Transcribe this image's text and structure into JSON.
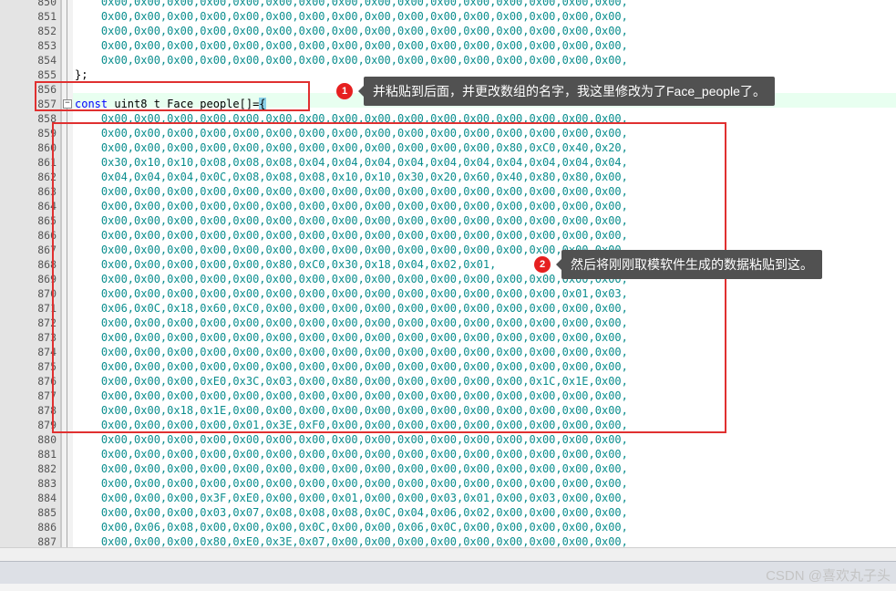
{
  "editor": {
    "lines": [
      {
        "no": "850",
        "text": "    0x00,0x00,0x00,0x00,0x00,0x00,0x00,0x00,0x00,0x00,0x00,0x00,0x00,0x00,0x00,0x00,"
      },
      {
        "no": "851",
        "text": "    0x00,0x00,0x00,0x00,0x00,0x00,0x00,0x00,0x00,0x00,0x00,0x00,0x00,0x00,0x00,0x00,"
      },
      {
        "no": "852",
        "text": "    0x00,0x00,0x00,0x00,0x00,0x00,0x00,0x00,0x00,0x00,0x00,0x00,0x00,0x00,0x00,0x00,"
      },
      {
        "no": "853",
        "text": "    0x00,0x00,0x00,0x00,0x00,0x00,0x00,0x00,0x00,0x00,0x00,0x00,0x00,0x00,0x00,0x00,"
      },
      {
        "no": "854",
        "text": "    0x00,0x00,0x00,0x00,0x00,0x00,0x00,0x00,0x00,0x00,0x00,0x00,0x00,0x00,0x00,0x00,"
      },
      {
        "no": "855",
        "text": "};"
      },
      {
        "no": "856",
        "text": ""
      },
      {
        "no": "857",
        "text": ""
      },
      {
        "no": "858",
        "text": "    0x00,0x00,0x00,0x00,0x00,0x00,0x00,0x00,0x00,0x00,0x00,0x00,0x00,0x00,0x00,0x00,"
      },
      {
        "no": "859",
        "text": "    0x00,0x00,0x00,0x00,0x00,0x00,0x00,0x00,0x00,0x00,0x00,0x00,0x00,0x00,0x00,0x00,"
      },
      {
        "no": "860",
        "text": "    0x00,0x00,0x00,0x00,0x00,0x00,0x00,0x00,0x00,0x00,0x00,0x00,0x80,0xC0,0x40,0x20,"
      },
      {
        "no": "861",
        "text": "    0x30,0x10,0x10,0x08,0x08,0x08,0x04,0x04,0x04,0x04,0x04,0x04,0x04,0x04,0x04,0x04,"
      },
      {
        "no": "862",
        "text": "    0x04,0x04,0x04,0x0C,0x08,0x08,0x08,0x10,0x10,0x30,0x20,0x60,0x40,0x80,0x80,0x00,"
      },
      {
        "no": "863",
        "text": "    0x00,0x00,0x00,0x00,0x00,0x00,0x00,0x00,0x00,0x00,0x00,0x00,0x00,0x00,0x00,0x00,"
      },
      {
        "no": "864",
        "text": "    0x00,0x00,0x00,0x00,0x00,0x00,0x00,0x00,0x00,0x00,0x00,0x00,0x00,0x00,0x00,0x00,"
      },
      {
        "no": "865",
        "text": "    0x00,0x00,0x00,0x00,0x00,0x00,0x00,0x00,0x00,0x00,0x00,0x00,0x00,0x00,0x00,0x00,"
      },
      {
        "no": "866",
        "text": "    0x00,0x00,0x00,0x00,0x00,0x00,0x00,0x00,0x00,0x00,0x00,0x00,0x00,0x00,0x00,0x00,"
      },
      {
        "no": "867",
        "text": "    0x00,0x00,0x00,0x00,0x00,0x00,0x00,0x00,0x00,0x00,0x00,0x00,0x00,0x00,0x00,0x00,"
      },
      {
        "no": "868",
        "text": "    0x00,0x00,0x00,0x00,0x00,0x80,0xC0,0x30,0x18,0x04,0x02,0x01,"
      },
      {
        "no": "869",
        "text": "    0x00,0x00,0x00,0x00,0x00,0x00,0x00,0x00,0x00,0x00,0x00,0x00,0x00,0x00,0x00,0x00,"
      },
      {
        "no": "870",
        "text": "    0x00,0x00,0x00,0x00,0x00,0x00,0x00,0x00,0x00,0x00,0x00,0x00,0x00,0x00,0x01,0x03,"
      },
      {
        "no": "871",
        "text": "    0x06,0x0C,0x18,0x60,0xC0,0x00,0x00,0x00,0x00,0x00,0x00,0x00,0x00,0x00,0x00,0x00,"
      },
      {
        "no": "872",
        "text": "    0x00,0x00,0x00,0x00,0x00,0x00,0x00,0x00,0x00,0x00,0x00,0x00,0x00,0x00,0x00,0x00,"
      },
      {
        "no": "873",
        "text": "    0x00,0x00,0x00,0x00,0x00,0x00,0x00,0x00,0x00,0x00,0x00,0x00,0x00,0x00,0x00,0x00,"
      },
      {
        "no": "874",
        "text": "    0x00,0x00,0x00,0x00,0x00,0x00,0x00,0x00,0x00,0x00,0x00,0x00,0x00,0x00,0x00,0x00,"
      },
      {
        "no": "875",
        "text": "    0x00,0x00,0x00,0x00,0x00,0x00,0x00,0x00,0x00,0x00,0x00,0x00,0x00,0x00,0x00,0x00,"
      },
      {
        "no": "876",
        "text": "    0x00,0x00,0x00,0xE0,0x3C,0x03,0x00,0x80,0x00,0x00,0x00,0x00,0x00,0x1C,0x1E,0x00,"
      },
      {
        "no": "877",
        "text": "    0x00,0x00,0x00,0x00,0x00,0x00,0x00,0x00,0x00,0x00,0x00,0x00,0x00,0x00,0x00,0x00,"
      },
      {
        "no": "878",
        "text": "    0x00,0x00,0x18,0x1E,0x00,0x00,0x00,0x00,0x00,0x00,0x00,0x00,0x00,0x00,0x00,0x00,"
      },
      {
        "no": "879",
        "text": "    0x00,0x00,0x00,0x00,0x01,0x3E,0xF0,0x00,0x00,0x00,0x00,0x00,0x00,0x00,0x00,0x00,"
      },
      {
        "no": "880",
        "text": "    0x00,0x00,0x00,0x00,0x00,0x00,0x00,0x00,0x00,0x00,0x00,0x00,0x00,0x00,0x00,0x00,"
      },
      {
        "no": "881",
        "text": "    0x00,0x00,0x00,0x00,0x00,0x00,0x00,0x00,0x00,0x00,0x00,0x00,0x00,0x00,0x00,0x00,"
      },
      {
        "no": "882",
        "text": "    0x00,0x00,0x00,0x00,0x00,0x00,0x00,0x00,0x00,0x00,0x00,0x00,0x00,0x00,0x00,0x00,"
      },
      {
        "no": "883",
        "text": "    0x00,0x00,0x00,0x00,0x00,0x00,0x00,0x00,0x00,0x00,0x00,0x00,0x00,0x00,0x00,0x00,"
      },
      {
        "no": "884",
        "text": "    0x00,0x00,0x00,0x3F,0xE0,0x00,0x00,0x01,0x00,0x00,0x03,0x01,0x00,0x03,0x00,0x00,"
      },
      {
        "no": "885",
        "text": "    0x00,0x00,0x00,0x03,0x07,0x08,0x08,0x08,0x0C,0x04,0x06,0x02,0x00,0x00,0x00,0x00,"
      },
      {
        "no": "886",
        "text": "    0x00,0x06,0x08,0x00,0x00,0x00,0x0C,0x00,0x00,0x06,0x0C,0x00,0x00,0x00,0x00,0x00,"
      },
      {
        "no": "887",
        "text": "    0x00,0x00,0x00,0x80,0xE0,0x3E,0x07,0x00,0x00,0x00,0x00,0x00,0x00,0x00,0x00,0x00,"
      }
    ],
    "decl": {
      "keyword": "const",
      "rest": " uint8_t Face_people[]=",
      "brace": "{"
    }
  },
  "callouts": [
    {
      "num": "1",
      "text": "并粘贴到后面，并更改数组的名字，我这里修改为了Face_people了。"
    },
    {
      "num": "2",
      "text": "然后将刚刚取模软件生成的数据粘贴到这。"
    }
  ],
  "watermark": "CSDN @喜欢丸子头",
  "colors": {
    "hex_literal": "#0a8e8e",
    "keyword": "#0000ff",
    "annotation_red": "#e03030",
    "tooltip_bg": "#515151"
  }
}
